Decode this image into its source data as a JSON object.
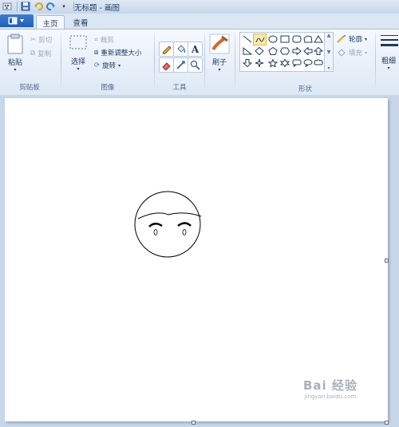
{
  "window": {
    "title": "无标题 - 画图"
  },
  "qat": {
    "icons": [
      "app-icon",
      "save-icon",
      "undo-icon",
      "redo-icon",
      "customize-icon"
    ]
  },
  "tabs": [
    {
      "label": "主页",
      "active": true
    },
    {
      "label": "查看",
      "active": false
    }
  ],
  "clipboard": {
    "paste": "粘贴",
    "cut": "剪切",
    "copy": "复制",
    "group": "剪贴板"
  },
  "image": {
    "select": "选择",
    "crop": "裁剪",
    "resize": "重新调整大小",
    "rotate": "旋转",
    "group": "图像"
  },
  "tools": {
    "group": "工具"
  },
  "brushes": {
    "label": "刷子"
  },
  "shapes": {
    "outline": "轮廓",
    "fill": "填充",
    "group": "形状"
  },
  "size": {
    "label": "粗细"
  },
  "watermark": {
    "text": "Bai 经验",
    "sub": "jingyan.baidu.com"
  },
  "colors": {
    "accent": "#1f5fb8",
    "ribbon": "#f5f9fe",
    "canvas_bg": "#c8d6e9"
  }
}
